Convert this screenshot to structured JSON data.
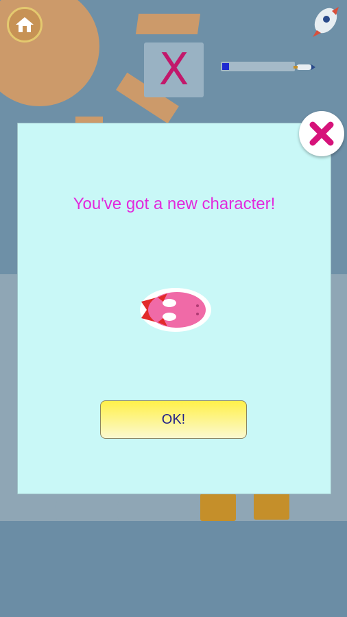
{
  "top_bar": {
    "home_icon": "home-icon",
    "rocket_icon": "rocket-icon",
    "letter": "X",
    "progress_fraction": 0.1
  },
  "dialog": {
    "message": "You've got a new character!",
    "ok_label": "OK!",
    "close_icon": "close-icon",
    "character": "pink-fish-character"
  },
  "bottom_controls": {
    "replay_icon": "replay-icon",
    "play_icon": "play-icon"
  },
  "colors": {
    "message": "#e229dc",
    "dialog_bg": "#c9f8f7",
    "ok_button_top": "#fff04a",
    "close_x": "#d6137a"
  }
}
